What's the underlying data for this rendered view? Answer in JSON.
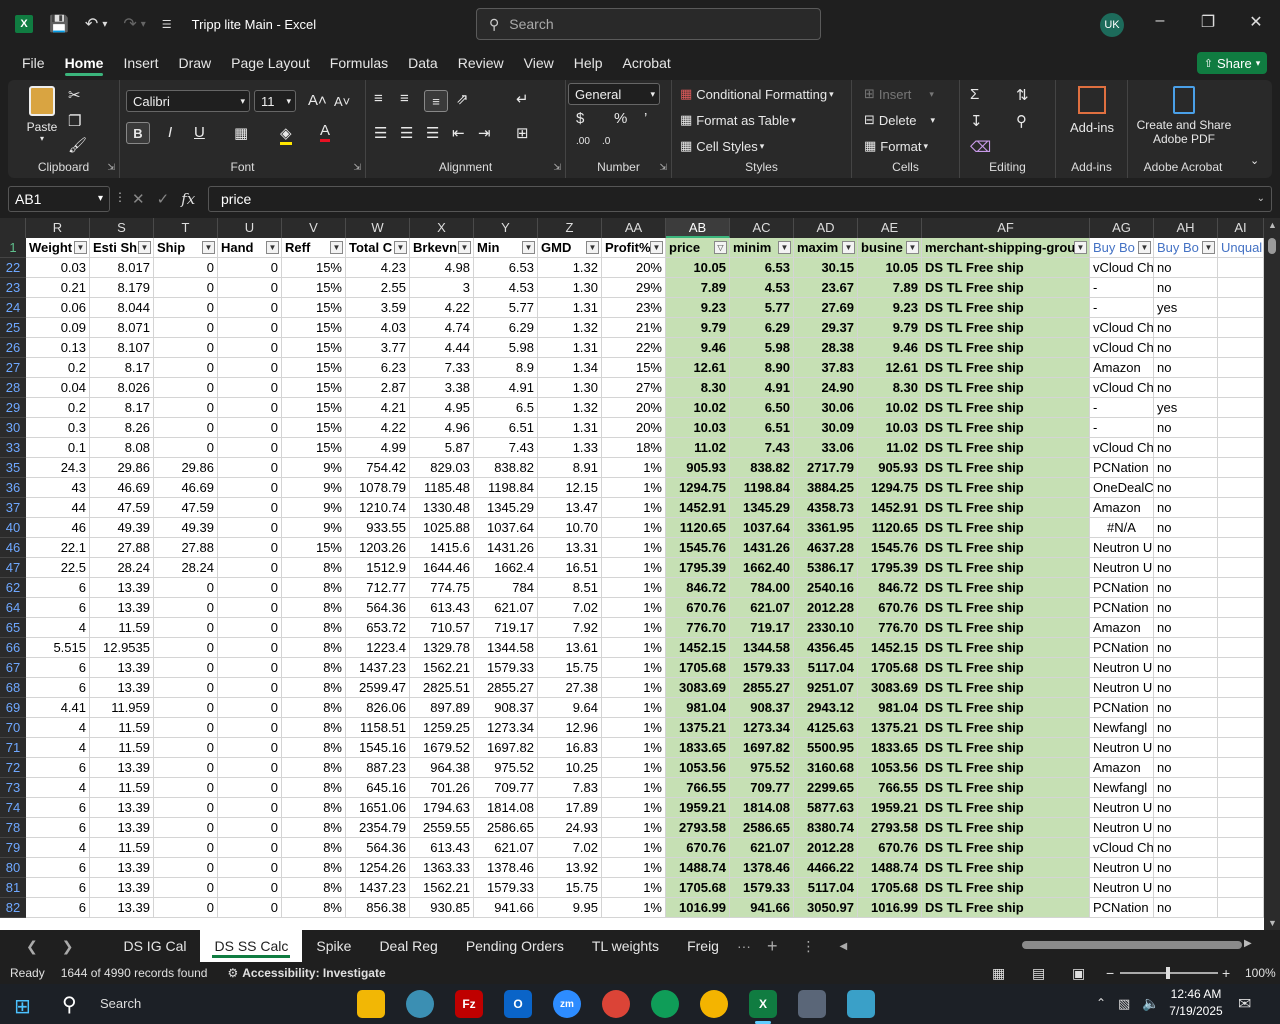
{
  "window": {
    "title": "Tripp lite Main  -  Excel",
    "search_placeholder": "Search",
    "user_initials": "UK"
  },
  "menu": {
    "tabs": [
      "File",
      "Home",
      "Insert",
      "Draw",
      "Page Layout",
      "Formulas",
      "Data",
      "Review",
      "View",
      "Help",
      "Acrobat"
    ],
    "active": "Home",
    "share_label": "Share"
  },
  "ribbon": {
    "clipboard": {
      "label": "Clipboard",
      "paste": "Paste"
    },
    "font": {
      "label": "Font",
      "name": "Calibri",
      "size": "11"
    },
    "alignment": {
      "label": "Alignment"
    },
    "number": {
      "label": "Number",
      "format": "General"
    },
    "styles": {
      "label": "Styles",
      "conditional": "Conditional Formatting",
      "format_table": "Format as Table",
      "cell_styles": "Cell Styles"
    },
    "cells": {
      "label": "Cells",
      "insert": "Insert",
      "delete": "Delete",
      "format": "Format"
    },
    "editing": {
      "label": "Editing"
    },
    "addins": {
      "label": "Add-ins",
      "button": "Add-ins"
    },
    "acrobat": {
      "label": "Adobe Acrobat",
      "button_line1": "Create and Share",
      "button_line2": "Adobe PDF"
    }
  },
  "formula_bar": {
    "name_box": "AB1",
    "formula": "price"
  },
  "grid": {
    "selected_column": "AB",
    "columns": [
      {
        "letter": "R",
        "header": "Weight",
        "align": "right"
      },
      {
        "letter": "S",
        "header": "Esti Shi",
        "align": "right"
      },
      {
        "letter": "T",
        "header": "Ship",
        "align": "right"
      },
      {
        "letter": "U",
        "header": "Hand",
        "align": "right"
      },
      {
        "letter": "V",
        "header": "Reff",
        "align": "right"
      },
      {
        "letter": "W",
        "header": "Total C",
        "align": "right"
      },
      {
        "letter": "X",
        "header": "Brkevn",
        "align": "right"
      },
      {
        "letter": "Y",
        "header": "Min",
        "align": "right"
      },
      {
        "letter": "Z",
        "header": "GMD",
        "align": "right"
      },
      {
        "letter": "AA",
        "header": "Profit%",
        "align": "right"
      },
      {
        "letter": "AB",
        "header": "price",
        "align": "right"
      },
      {
        "letter": "AC",
        "header": "minim",
        "align": "right"
      },
      {
        "letter": "AD",
        "header": "maxim",
        "align": "right"
      },
      {
        "letter": "AE",
        "header": "busine",
        "align": "right"
      },
      {
        "letter": "AF",
        "header": "merchant-shipping-grou",
        "align": "left"
      },
      {
        "letter": "AG",
        "header": "Buy Bo",
        "align": "left"
      },
      {
        "letter": "AH",
        "header": "Buy Bo",
        "align": "left"
      },
      {
        "letter": "AI",
        "header": "Unqual",
        "align": "left"
      }
    ],
    "rows": [
      {
        "n": "22",
        "c": [
          "0.03",
          "8.017",
          "0",
          "0",
          "15%",
          "4.23",
          "4.98",
          "6.53",
          "1.32",
          "20%",
          "10.05",
          "6.53",
          "30.15",
          "10.05",
          "DS TL Free ship",
          "vCloud Ch",
          "no",
          ""
        ]
      },
      {
        "n": "23",
        "c": [
          "0.21",
          "8.179",
          "0",
          "0",
          "15%",
          "2.55",
          "3",
          "4.53",
          "1.30",
          "29%",
          "7.89",
          "4.53",
          "23.67",
          "7.89",
          "DS TL Free ship",
          "-",
          "no",
          ""
        ]
      },
      {
        "n": "24",
        "c": [
          "0.06",
          "8.044",
          "0",
          "0",
          "15%",
          "3.59",
          "4.22",
          "5.77",
          "1.31",
          "23%",
          "9.23",
          "5.77",
          "27.69",
          "9.23",
          "DS TL Free ship",
          "-",
          "yes",
          ""
        ]
      },
      {
        "n": "25",
        "c": [
          "0.09",
          "8.071",
          "0",
          "0",
          "15%",
          "4.03",
          "4.74",
          "6.29",
          "1.32",
          "21%",
          "9.79",
          "6.29",
          "29.37",
          "9.79",
          "DS TL Free ship",
          "vCloud Ch",
          "no",
          ""
        ]
      },
      {
        "n": "26",
        "c": [
          "0.13",
          "8.107",
          "0",
          "0",
          "15%",
          "3.77",
          "4.44",
          "5.98",
          "1.31",
          "22%",
          "9.46",
          "5.98",
          "28.38",
          "9.46",
          "DS TL Free ship",
          "vCloud Ch",
          "no",
          ""
        ]
      },
      {
        "n": "27",
        "c": [
          "0.2",
          "8.17",
          "0",
          "0",
          "15%",
          "6.23",
          "7.33",
          "8.9",
          "1.34",
          "15%",
          "12.61",
          "8.90",
          "37.83",
          "12.61",
          "DS TL Free ship",
          "Amazon",
          "no",
          ""
        ]
      },
      {
        "n": "28",
        "c": [
          "0.04",
          "8.026",
          "0",
          "0",
          "15%",
          "2.87",
          "3.38",
          "4.91",
          "1.30",
          "27%",
          "8.30",
          "4.91",
          "24.90",
          "8.30",
          "DS TL Free ship",
          "vCloud Ch",
          "no",
          ""
        ]
      },
      {
        "n": "29",
        "c": [
          "0.2",
          "8.17",
          "0",
          "0",
          "15%",
          "4.21",
          "4.95",
          "6.5",
          "1.32",
          "20%",
          "10.02",
          "6.50",
          "30.06",
          "10.02",
          "DS TL Free ship",
          "-",
          "yes",
          ""
        ]
      },
      {
        "n": "30",
        "c": [
          "0.3",
          "8.26",
          "0",
          "0",
          "15%",
          "4.22",
          "4.96",
          "6.51",
          "1.31",
          "20%",
          "10.03",
          "6.51",
          "30.09",
          "10.03",
          "DS TL Free ship",
          "-",
          "no",
          ""
        ]
      },
      {
        "n": "33",
        "c": [
          "0.1",
          "8.08",
          "0",
          "0",
          "15%",
          "4.99",
          "5.87",
          "7.43",
          "1.33",
          "18%",
          "11.02",
          "7.43",
          "33.06",
          "11.02",
          "DS TL Free ship",
          "vCloud Ch",
          "no",
          ""
        ]
      },
      {
        "n": "35",
        "c": [
          "24.3",
          "29.86",
          "29.86",
          "0",
          "9%",
          "754.42",
          "829.03",
          "838.82",
          "8.91",
          "1%",
          "905.93",
          "838.82",
          "2717.79",
          "905.93",
          "DS TL Free ship",
          "PCNation",
          "no",
          ""
        ]
      },
      {
        "n": "36",
        "c": [
          "43",
          "46.69",
          "46.69",
          "0",
          "9%",
          "1078.79",
          "1185.48",
          "1198.84",
          "12.15",
          "1%",
          "1294.75",
          "1198.84",
          "3884.25",
          "1294.75",
          "DS TL Free ship",
          "OneDealC",
          "no",
          ""
        ]
      },
      {
        "n": "37",
        "c": [
          "44",
          "47.59",
          "47.59",
          "0",
          "9%",
          "1210.74",
          "1330.48",
          "1345.29",
          "13.47",
          "1%",
          "1452.91",
          "1345.29",
          "4358.73",
          "1452.91",
          "DS TL Free ship",
          "Amazon",
          "no",
          ""
        ]
      },
      {
        "n": "40",
        "c": [
          "46",
          "49.39",
          "49.39",
          "0",
          "9%",
          "933.55",
          "1025.88",
          "1037.64",
          "10.70",
          "1%",
          "1120.65",
          "1037.64",
          "3361.95",
          "1120.65",
          "DS TL Free ship",
          "#N/A",
          "no",
          ""
        ]
      },
      {
        "n": "46",
        "c": [
          "22.1",
          "27.88",
          "27.88",
          "0",
          "15%",
          "1203.26",
          "1415.6",
          "1431.26",
          "13.31",
          "1%",
          "1545.76",
          "1431.26",
          "4637.28",
          "1545.76",
          "DS TL Free ship",
          "Neutron U",
          "no",
          ""
        ]
      },
      {
        "n": "47",
        "c": [
          "22.5",
          "28.24",
          "28.24",
          "0",
          "8%",
          "1512.9",
          "1644.46",
          "1662.4",
          "16.51",
          "1%",
          "1795.39",
          "1662.40",
          "5386.17",
          "1795.39",
          "DS TL Free ship",
          "Neutron U",
          "no",
          ""
        ]
      },
      {
        "n": "62",
        "c": [
          "6",
          "13.39",
          "0",
          "0",
          "8%",
          "712.77",
          "774.75",
          "784",
          "8.51",
          "1%",
          "846.72",
          "784.00",
          "2540.16",
          "846.72",
          "DS TL Free ship",
          "PCNation",
          "no",
          ""
        ]
      },
      {
        "n": "64",
        "c": [
          "6",
          "13.39",
          "0",
          "0",
          "8%",
          "564.36",
          "613.43",
          "621.07",
          "7.02",
          "1%",
          "670.76",
          "621.07",
          "2012.28",
          "670.76",
          "DS TL Free ship",
          "PCNation",
          "no",
          ""
        ]
      },
      {
        "n": "65",
        "c": [
          "4",
          "11.59",
          "0",
          "0",
          "8%",
          "653.72",
          "710.57",
          "719.17",
          "7.92",
          "1%",
          "776.70",
          "719.17",
          "2330.10",
          "776.70",
          "DS TL Free ship",
          "Amazon",
          "no",
          ""
        ]
      },
      {
        "n": "66",
        "c": [
          "5.515",
          "12.9535",
          "0",
          "0",
          "8%",
          "1223.4",
          "1329.78",
          "1344.58",
          "13.61",
          "1%",
          "1452.15",
          "1344.58",
          "4356.45",
          "1452.15",
          "DS TL Free ship",
          "PCNation",
          "no",
          ""
        ]
      },
      {
        "n": "67",
        "c": [
          "6",
          "13.39",
          "0",
          "0",
          "8%",
          "1437.23",
          "1562.21",
          "1579.33",
          "15.75",
          "1%",
          "1705.68",
          "1579.33",
          "5117.04",
          "1705.68",
          "DS TL Free ship",
          "Neutron U",
          "no",
          ""
        ]
      },
      {
        "n": "68",
        "c": [
          "6",
          "13.39",
          "0",
          "0",
          "8%",
          "2599.47",
          "2825.51",
          "2855.27",
          "27.38",
          "1%",
          "3083.69",
          "2855.27",
          "9251.07",
          "3083.69",
          "DS TL Free ship",
          "Neutron U",
          "no",
          ""
        ]
      },
      {
        "n": "69",
        "c": [
          "4.41",
          "11.959",
          "0",
          "0",
          "8%",
          "826.06",
          "897.89",
          "908.37",
          "9.64",
          "1%",
          "981.04",
          "908.37",
          "2943.12",
          "981.04",
          "DS TL Free ship",
          "PCNation",
          "no",
          ""
        ]
      },
      {
        "n": "70",
        "c": [
          "4",
          "11.59",
          "0",
          "0",
          "8%",
          "1158.51",
          "1259.25",
          "1273.34",
          "12.96",
          "1%",
          "1375.21",
          "1273.34",
          "4125.63",
          "1375.21",
          "DS TL Free ship",
          "Newfangl",
          "no",
          ""
        ]
      },
      {
        "n": "71",
        "c": [
          "4",
          "11.59",
          "0",
          "0",
          "8%",
          "1545.16",
          "1679.52",
          "1697.82",
          "16.83",
          "1%",
          "1833.65",
          "1697.82",
          "5500.95",
          "1833.65",
          "DS TL Free ship",
          "Neutron U",
          "no",
          ""
        ]
      },
      {
        "n": "72",
        "c": [
          "6",
          "13.39",
          "0",
          "0",
          "8%",
          "887.23",
          "964.38",
          "975.52",
          "10.25",
          "1%",
          "1053.56",
          "975.52",
          "3160.68",
          "1053.56",
          "DS TL Free ship",
          "Amazon",
          "no",
          ""
        ]
      },
      {
        "n": "73",
        "c": [
          "4",
          "11.59",
          "0",
          "0",
          "8%",
          "645.16",
          "701.26",
          "709.77",
          "7.83",
          "1%",
          "766.55",
          "709.77",
          "2299.65",
          "766.55",
          "DS TL Free ship",
          "Newfangl",
          "no",
          ""
        ]
      },
      {
        "n": "74",
        "c": [
          "6",
          "13.39",
          "0",
          "0",
          "8%",
          "1651.06",
          "1794.63",
          "1814.08",
          "17.89",
          "1%",
          "1959.21",
          "1814.08",
          "5877.63",
          "1959.21",
          "DS TL Free ship",
          "Neutron U",
          "no",
          ""
        ]
      },
      {
        "n": "78",
        "c": [
          "6",
          "13.39",
          "0",
          "0",
          "8%",
          "2354.79",
          "2559.55",
          "2586.65",
          "24.93",
          "1%",
          "2793.58",
          "2586.65",
          "8380.74",
          "2793.58",
          "DS TL Free ship",
          "Neutron U",
          "no",
          ""
        ]
      },
      {
        "n": "79",
        "c": [
          "4",
          "11.59",
          "0",
          "0",
          "8%",
          "564.36",
          "613.43",
          "621.07",
          "7.02",
          "1%",
          "670.76",
          "621.07",
          "2012.28",
          "670.76",
          "DS TL Free ship",
          "vCloud Ch",
          "no",
          ""
        ]
      },
      {
        "n": "80",
        "c": [
          "6",
          "13.39",
          "0",
          "0",
          "8%",
          "1254.26",
          "1363.33",
          "1378.46",
          "13.92",
          "1%",
          "1488.74",
          "1378.46",
          "4466.22",
          "1488.74",
          "DS TL Free ship",
          "Neutron U",
          "no",
          ""
        ]
      },
      {
        "n": "81",
        "c": [
          "6",
          "13.39",
          "0",
          "0",
          "8%",
          "1437.23",
          "1562.21",
          "1579.33",
          "15.75",
          "1%",
          "1705.68",
          "1579.33",
          "5117.04",
          "1705.68",
          "DS TL Free ship",
          "Neutron U",
          "no",
          ""
        ]
      },
      {
        "n": "82",
        "c": [
          "6",
          "13.39",
          "0",
          "0",
          "8%",
          "856.38",
          "930.85",
          "941.66",
          "9.95",
          "1%",
          "1016.99",
          "941.66",
          "3050.97",
          "1016.99",
          "DS TL Free ship",
          "PCNation",
          "no",
          ""
        ]
      }
    ]
  },
  "sheets": {
    "tabs": [
      "DS IG Cal",
      "DS SS Calc",
      "Spike",
      "Deal Reg",
      "Pending Orders",
      "TL weights",
      "Freig"
    ],
    "active": "DS SS Calc",
    "more": "···",
    "add": "+"
  },
  "status": {
    "ready": "Ready",
    "records": "1644 of 4990 records found",
    "accessibility": "Accessibility: Investigate",
    "zoom": "100%"
  },
  "taskbar": {
    "search_label": "Search",
    "time": "12:46 AM",
    "date": "7/19/2025"
  },
  "colors": {
    "accent_green": "#107c41",
    "highlight_cell": "#c6e0b4",
    "header_blue_text": "#4472c4"
  }
}
